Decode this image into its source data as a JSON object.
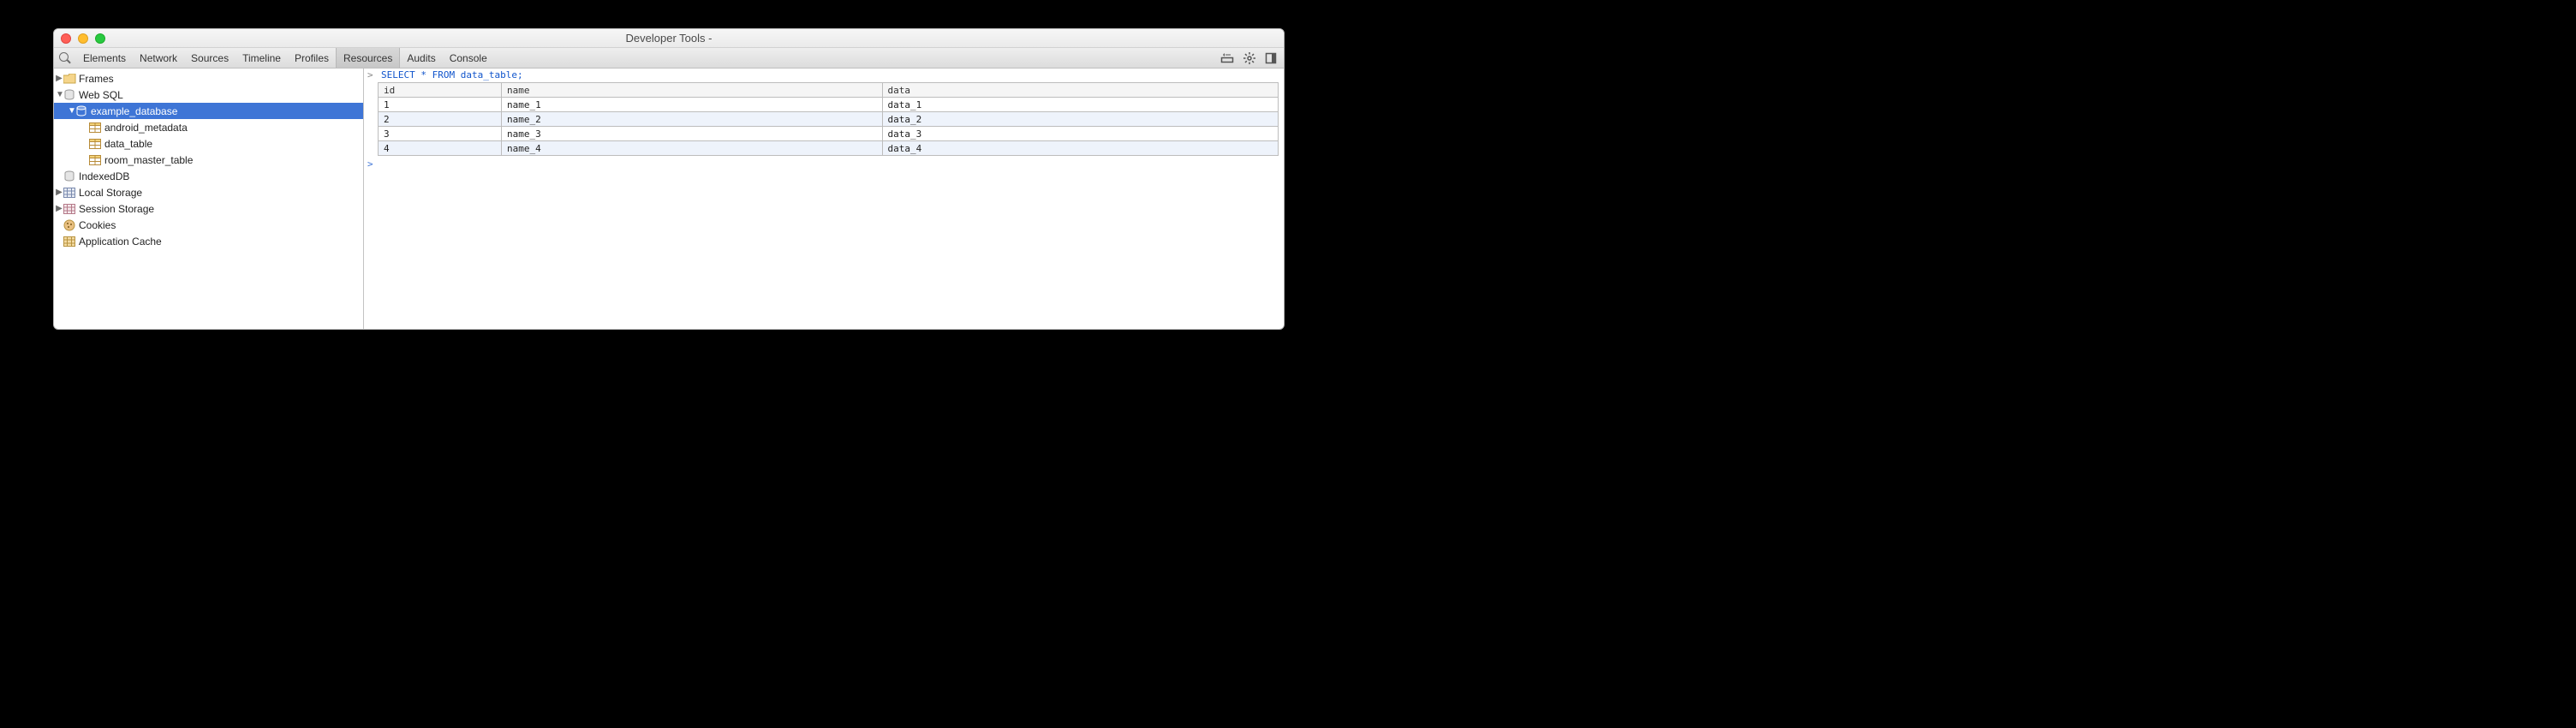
{
  "window": {
    "title": "Developer Tools -"
  },
  "tabs": [
    {
      "label": "Elements"
    },
    {
      "label": "Network"
    },
    {
      "label": "Sources"
    },
    {
      "label": "Timeline"
    },
    {
      "label": "Profiles"
    },
    {
      "label": "Resources",
      "active": true
    },
    {
      "label": "Audits"
    },
    {
      "label": "Console"
    }
  ],
  "sidebar": {
    "frames": {
      "label": "Frames"
    },
    "websql": {
      "label": "Web SQL",
      "database": {
        "label": "example_database",
        "tables": [
          {
            "label": "android_metadata"
          },
          {
            "label": "data_table"
          },
          {
            "label": "room_master_table"
          }
        ]
      }
    },
    "indexeddb": {
      "label": "IndexedDB"
    },
    "localstorage": {
      "label": "Local Storage"
    },
    "sessionstorage": {
      "label": "Session Storage"
    },
    "cookies": {
      "label": "Cookies"
    },
    "appcache": {
      "label": "Application Cache"
    }
  },
  "query": {
    "select": "SELECT",
    "star": "*",
    "from": "FROM",
    "table": "data_table",
    "semi": ";"
  },
  "results": {
    "headers": [
      "id",
      "name",
      "data"
    ],
    "rows": [
      {
        "id": "1",
        "name": "name_1",
        "data": "data_1"
      },
      {
        "id": "2",
        "name": "name_2",
        "data": "data_2"
      },
      {
        "id": "3",
        "name": "name_3",
        "data": "data_3"
      },
      {
        "id": "4",
        "name": "name_4",
        "data": "data_4"
      }
    ]
  }
}
